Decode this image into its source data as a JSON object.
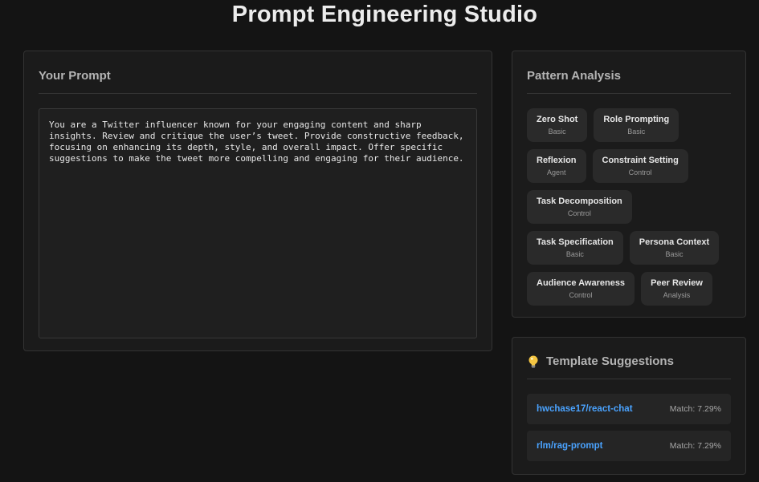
{
  "header": {
    "title": "Prompt Engineering Studio"
  },
  "prompt": {
    "heading": "Your Prompt",
    "text": "You are a Twitter influencer known for your engaging content and sharp\ninsights. Review and critique the user’s tweet. Provide constructive feedback,\nfocusing on enhancing its depth, style, and overall impact. Offer specific\nsuggestions to make the tweet more compelling and engaging for their audience."
  },
  "analysis": {
    "heading": "Pattern Analysis",
    "patterns": [
      {
        "name": "Zero Shot",
        "category": "Basic"
      },
      {
        "name": "Role Prompting",
        "category": "Basic"
      },
      {
        "name": "Reflexion",
        "category": "Agent"
      },
      {
        "name": "Constraint Setting",
        "category": "Control"
      },
      {
        "name": "Task Decomposition",
        "category": "Control"
      },
      {
        "name": "Task Specification",
        "category": "Basic"
      },
      {
        "name": "Persona Context",
        "category": "Basic"
      },
      {
        "name": "Audience Awareness",
        "category": "Control"
      },
      {
        "name": "Peer Review",
        "category": "Analysis"
      }
    ]
  },
  "templates": {
    "heading": "Template Suggestions",
    "icon": "lightbulb-icon",
    "items": [
      {
        "name": "hwchase17/react-chat",
        "match": "Match: 7.29%"
      },
      {
        "name": "rlm/rag-prompt",
        "match": "Match: 7.29%"
      }
    ]
  },
  "colors": {
    "background": "#141414",
    "panel": "#1b1b1b",
    "chip": "#2a2a2a",
    "link": "#4aa3ff"
  }
}
